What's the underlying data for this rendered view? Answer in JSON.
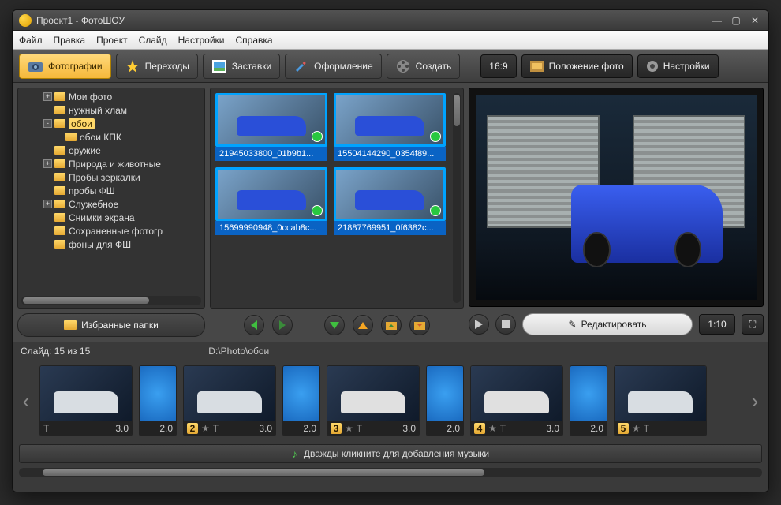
{
  "titlebar": {
    "title": "Проект1 - ФотоШОУ"
  },
  "menu": [
    "Файл",
    "Правка",
    "Проект",
    "Слайд",
    "Настройки",
    "Справка"
  ],
  "tabs": [
    {
      "label": "Фотографии",
      "active": true
    },
    {
      "label": "Переходы"
    },
    {
      "label": "Заставки"
    },
    {
      "label": "Оформление"
    },
    {
      "label": "Создать"
    }
  ],
  "right_buttons": {
    "aspect": "16:9",
    "position": "Положение фото",
    "settings": "Настройки"
  },
  "tree": [
    {
      "indent": 2,
      "exp": "+",
      "label": "Мои фото"
    },
    {
      "indent": 2,
      "exp": "",
      "label": "нужный хлам"
    },
    {
      "indent": 2,
      "exp": "-",
      "label": "обои",
      "sel": true
    },
    {
      "indent": 3,
      "exp": "",
      "label": "обои КПК"
    },
    {
      "indent": 2,
      "exp": "",
      "label": "оружие"
    },
    {
      "indent": 2,
      "exp": "+",
      "label": "Природа и животные"
    },
    {
      "indent": 2,
      "exp": "",
      "label": "Пробы зеркалки"
    },
    {
      "indent": 2,
      "exp": "",
      "label": "пробы ФШ"
    },
    {
      "indent": 2,
      "exp": "+",
      "label": "Служебное"
    },
    {
      "indent": 2,
      "exp": "",
      "label": "Снимки экрана"
    },
    {
      "indent": 2,
      "exp": "",
      "label": "Сохраненные фотогр"
    },
    {
      "indent": 2,
      "exp": "",
      "label": "фоны для ФШ"
    }
  ],
  "favorites_label": "Избранные папки",
  "thumbs": [
    {
      "name": "21945033800_01b9b1..."
    },
    {
      "name": "15504144290_0354f89..."
    },
    {
      "name": "15699990948_0ccab8c..."
    },
    {
      "name": "21887769951_0f6382c..."
    }
  ],
  "edit_label": "Редактировать",
  "time": "1:10",
  "status": {
    "slide": "Слайд: 15 из 15",
    "path": "D:\\Photo\\обои"
  },
  "timeline": {
    "slides": [
      {
        "num": "",
        "dur": "3.0"
      },
      {
        "trans": true,
        "dur": "2.0"
      },
      {
        "num": "2",
        "dur": "3.0"
      },
      {
        "trans": true,
        "dur": "2.0"
      },
      {
        "num": "3",
        "dur": "3.0"
      },
      {
        "trans": true,
        "dur": "2.0"
      },
      {
        "num": "4",
        "dur": "3.0"
      },
      {
        "trans": true,
        "dur": "2.0"
      },
      {
        "num": "5",
        "dur": ""
      }
    ],
    "music_hint": "Дважды кликните для добавления музыки"
  }
}
